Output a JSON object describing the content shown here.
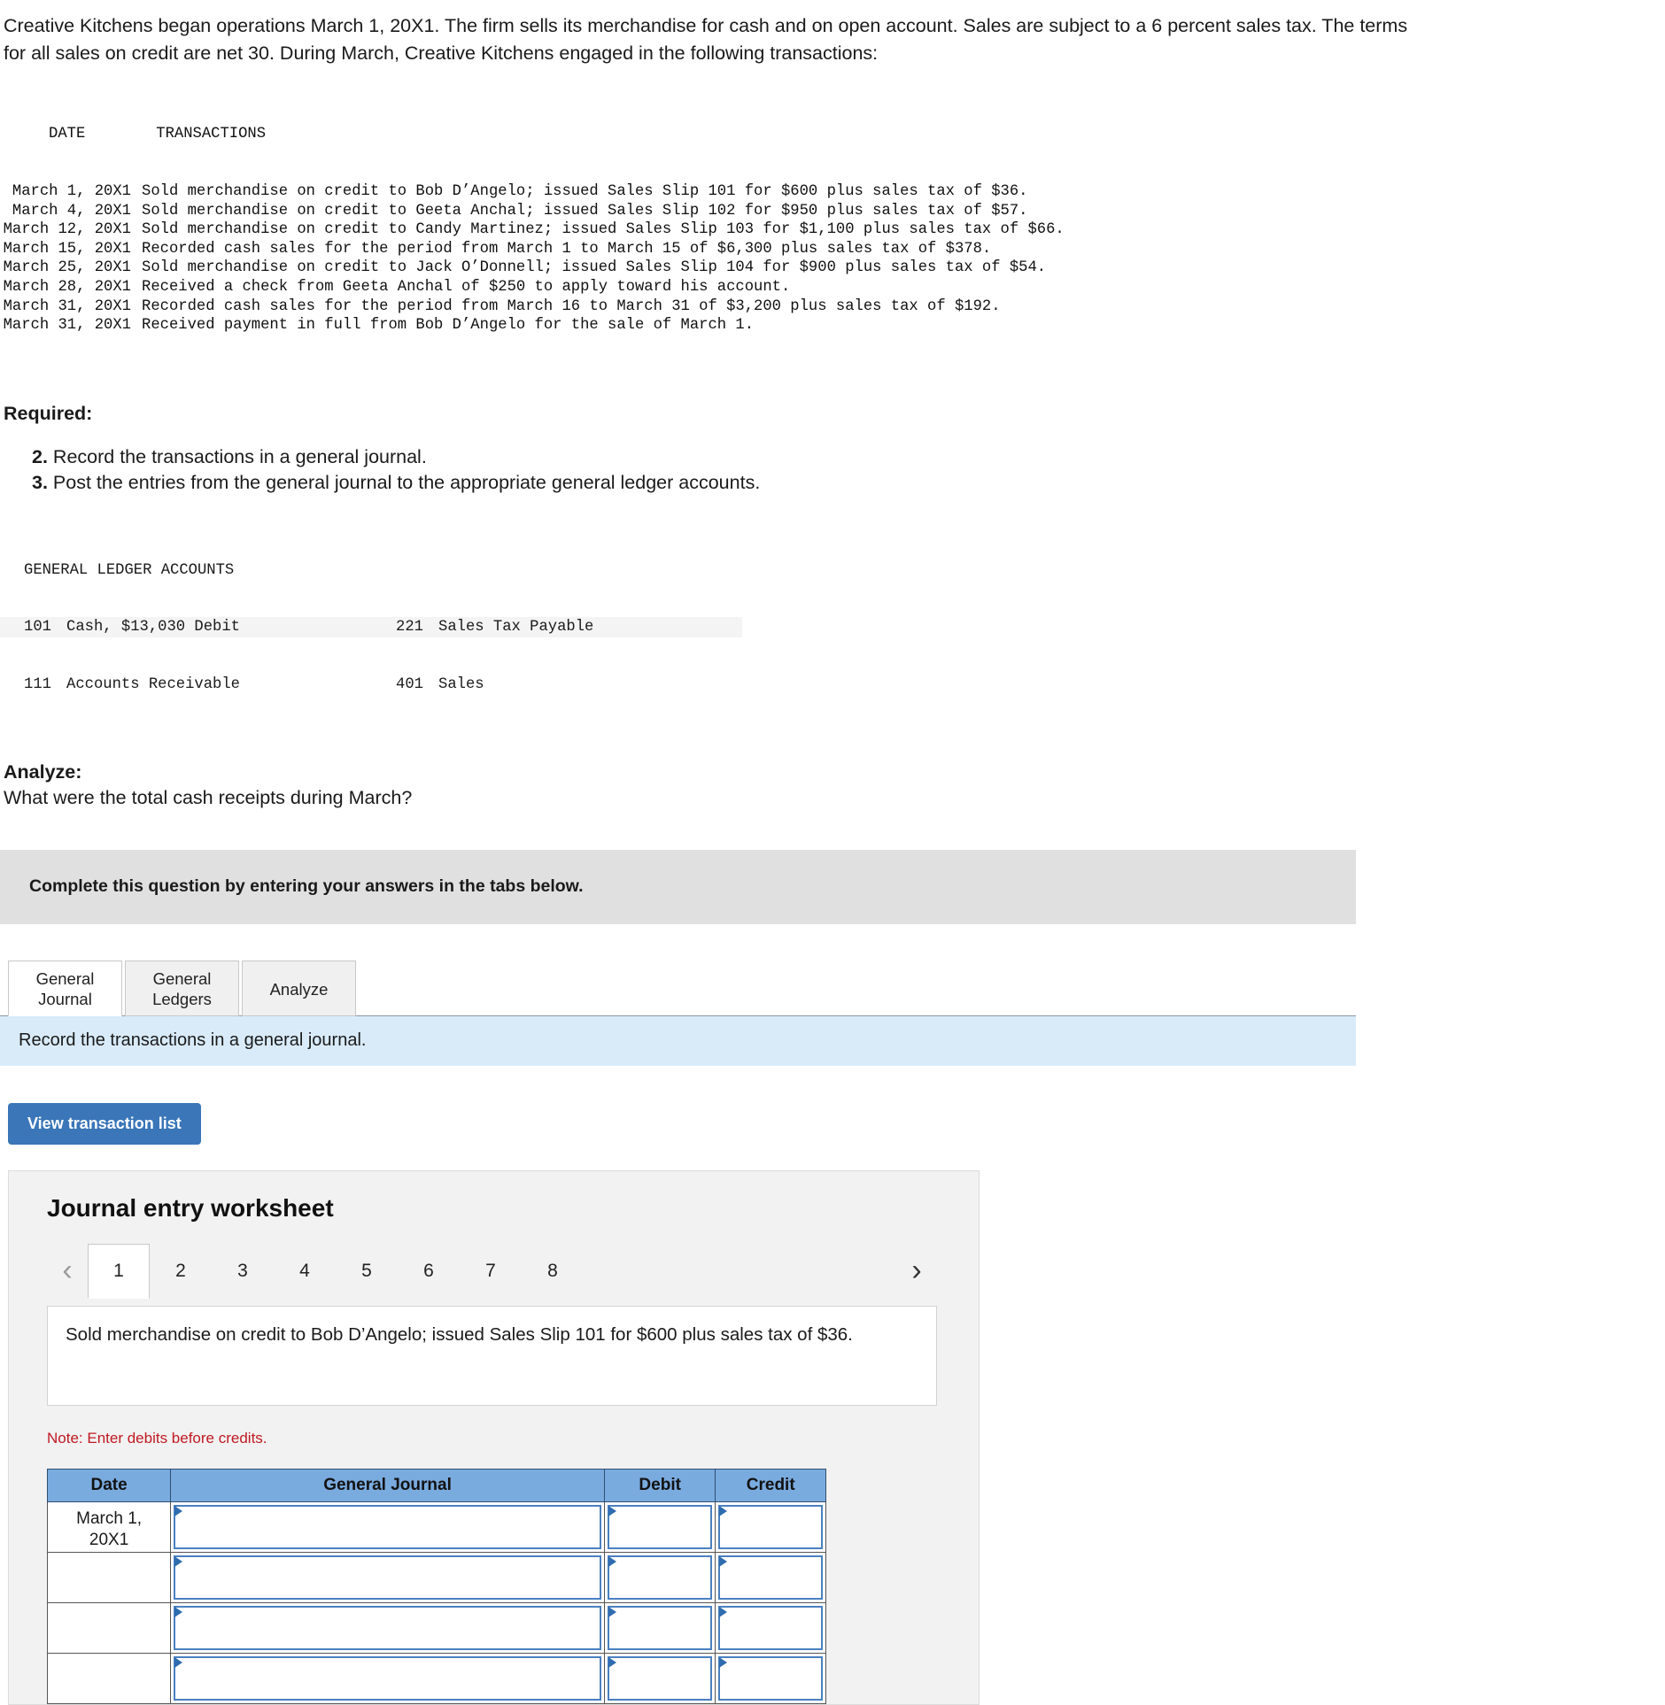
{
  "intro": {
    "paragraph": "Creative Kitchens began operations March 1, 20X1. The firm sells its merchandise for cash and on open account. Sales are subject to a 6 percent sales tax. The terms for all sales on credit are net 30. During March, Creative Kitchens engaged in the following transactions:"
  },
  "transactions_table": {
    "header_date": "DATE",
    "header_transactions": "TRANSACTIONS",
    "rows": [
      {
        "date": "March 1, 20X1",
        "desc": "Sold merchandise on credit to Bob D’Angelo; issued Sales Slip 101 for $600 plus sales tax of $36."
      },
      {
        "date": "March 4, 20X1",
        "desc": "Sold merchandise on credit to Geeta Anchal; issued Sales Slip 102 for $950 plus sales tax of $57."
      },
      {
        "date": "March 12, 20X1",
        "desc": "Sold merchandise on credit to Candy Martinez; issued Sales Slip 103 for $1,100 plus sales tax of $66."
      },
      {
        "date": "March 15, 20X1",
        "desc": "Recorded cash sales for the period from March 1 to March 15 of $6,300 plus sales tax of $378."
      },
      {
        "date": "March 25, 20X1",
        "desc": "Sold merchandise on credit to Jack O’Donnell; issued Sales Slip 104 for $900 plus sales tax of $54."
      },
      {
        "date": "March 28, 20X1",
        "desc": "Received a check from Geeta Anchal of $250 to apply toward his account."
      },
      {
        "date": "March 31, 20X1",
        "desc": "Recorded cash sales for the period from March 16 to March 31 of $3,200 plus sales tax of $192."
      },
      {
        "date": "March 31, 20X1",
        "desc": "Received payment in full from Bob D’Angelo for the sale of March 1."
      }
    ]
  },
  "required": {
    "title": "Required:",
    "items": [
      {
        "num": "2.",
        "text": "Record the transactions in a general journal."
      },
      {
        "num": "3.",
        "text": "Post the entries from the general journal to the appropriate general ledger accounts."
      }
    ]
  },
  "ledger_accounts": {
    "title": "GENERAL LEDGER ACCOUNTS",
    "rows": [
      {
        "left_num": "101",
        "left_name": "Cash, $13,030 Debit",
        "right_num": "221",
        "right_name": "Sales Tax Payable"
      },
      {
        "left_num": "111",
        "left_name": "Accounts Receivable",
        "right_num": "401",
        "right_name": "Sales"
      }
    ]
  },
  "analyze": {
    "title": "Analyze:",
    "question": "What were the total cash receipts during March?"
  },
  "banner": {
    "text": "Complete this question by entering your answers in the tabs below."
  },
  "tabs": {
    "items": [
      {
        "line1": "General",
        "line2": "Journal",
        "active": true
      },
      {
        "line1": "General",
        "line2": "Ledgers",
        "active": false
      },
      {
        "line1": "Analyze",
        "line2": "",
        "active": false
      }
    ]
  },
  "instruction_bar": {
    "text": "Record the transactions in a general journal."
  },
  "view_transaction_button": {
    "label": "View transaction list"
  },
  "worksheet": {
    "title": "Journal entry worksheet",
    "prev_arrow": "‹",
    "next_arrow": "›",
    "pages": [
      "1",
      "2",
      "3",
      "4",
      "5",
      "6",
      "7",
      "8"
    ],
    "active_page": "1",
    "description": "Sold merchandise on credit to Bob D’Angelo; issued Sales Slip 101 for $600 plus sales tax of $36.",
    "note": "Note: Enter debits before credits.",
    "table": {
      "headers": [
        "Date",
        "General Journal",
        "Debit",
        "Credit"
      ],
      "rows": [
        {
          "date": "March 1,\n20X1",
          "general_journal": "",
          "debit": "",
          "credit": ""
        },
        {
          "date": "",
          "general_journal": "",
          "debit": "",
          "credit": ""
        },
        {
          "date": "",
          "general_journal": "",
          "debit": "",
          "credit": ""
        },
        {
          "date": "",
          "general_journal": "",
          "debit": "",
          "credit": ""
        }
      ]
    }
  },
  "colors": {
    "banner_grey": "#e0e0e0",
    "instruction_blue": "#d9ebf9",
    "button_blue": "#3a76b8",
    "table_header_blue": "#7aabdf",
    "note_red": "#c01922",
    "input_border_blue": "#4a80c0"
  }
}
